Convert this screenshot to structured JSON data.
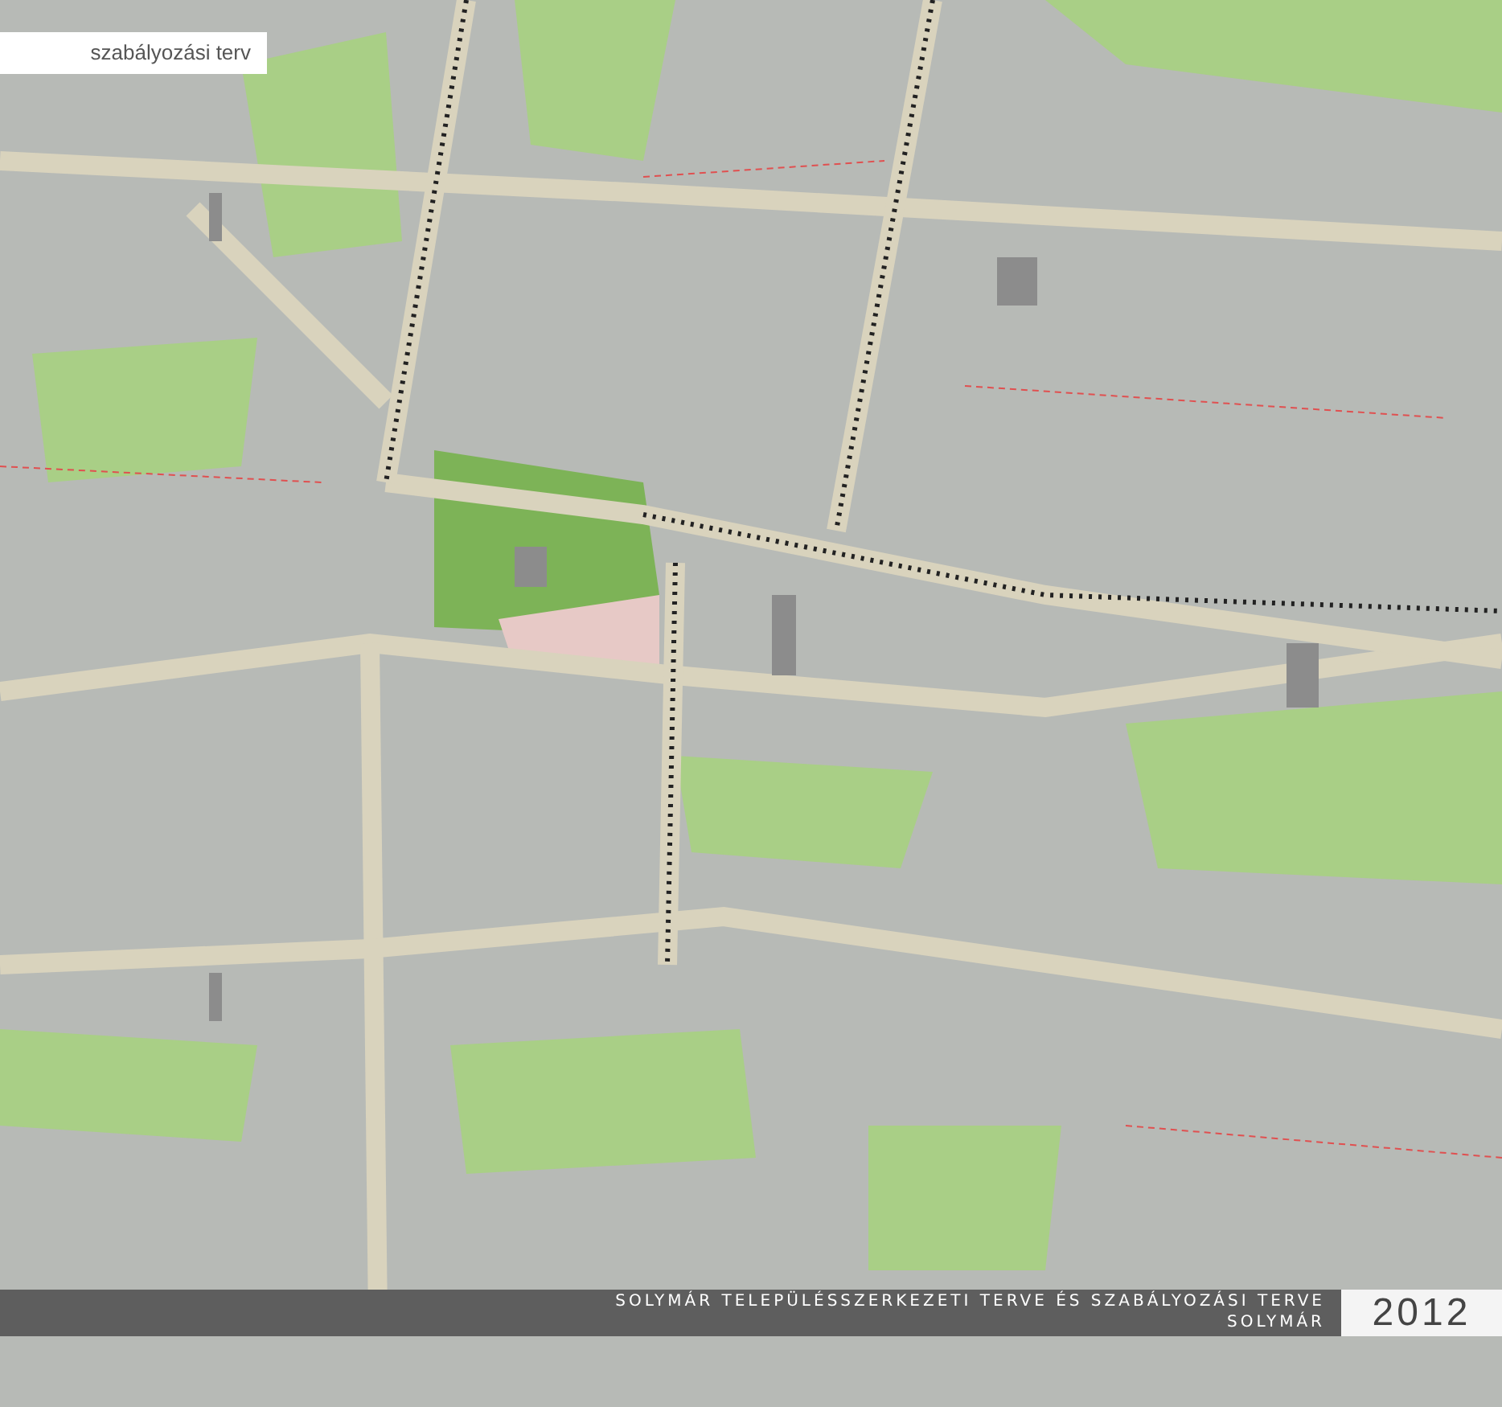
{
  "section_label": "szabályozási terv",
  "footer": {
    "title": "SOLYMÁR TELEPÜLÉSSZERKEZETI TERVE ÉS SZABÁLYOZÁSI TERVE",
    "subtitle": "SOLYMÁR",
    "year": "2012"
  }
}
